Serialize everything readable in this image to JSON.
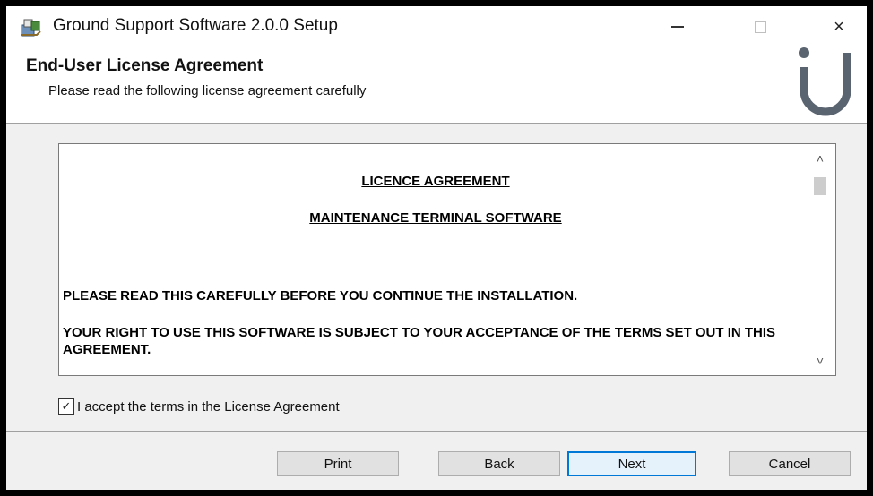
{
  "window": {
    "title": "Ground Support Software 2.0.0 Setup",
    "close_glyph": "×"
  },
  "banner": {
    "title": "End-User License Agreement",
    "subtitle": "Please read the following license agreement carefully"
  },
  "license": {
    "heading_1": "LICENCE AGREEMENT",
    "heading_2": "MAINTENANCE TERMINAL SOFTWARE",
    "paragraph_1": "PLEASE READ THIS CAREFULLY BEFORE YOU CONTINUE THE INSTALLATION.",
    "paragraph_2": "YOUR RIGHT TO USE THIS SOFTWARE IS SUBJECT TO YOUR ACCEPTANCE OF THE TERMS SET OUT IN THIS AGREEMENT.",
    "scroll_up_glyph": "˄",
    "scroll_down_glyph": "˅"
  },
  "accept": {
    "label": "I accept the terms in the License Agreement",
    "checked": true,
    "check_glyph": "✓"
  },
  "buttons": {
    "print": "Print",
    "back": "Back",
    "next": "Next",
    "cancel": "Cancel"
  },
  "colors": {
    "logo": "#5a6470",
    "focus_border": "#0078d7"
  },
  "icons": {
    "app": "installer-package-icon",
    "logo": "brand-u-logo"
  }
}
